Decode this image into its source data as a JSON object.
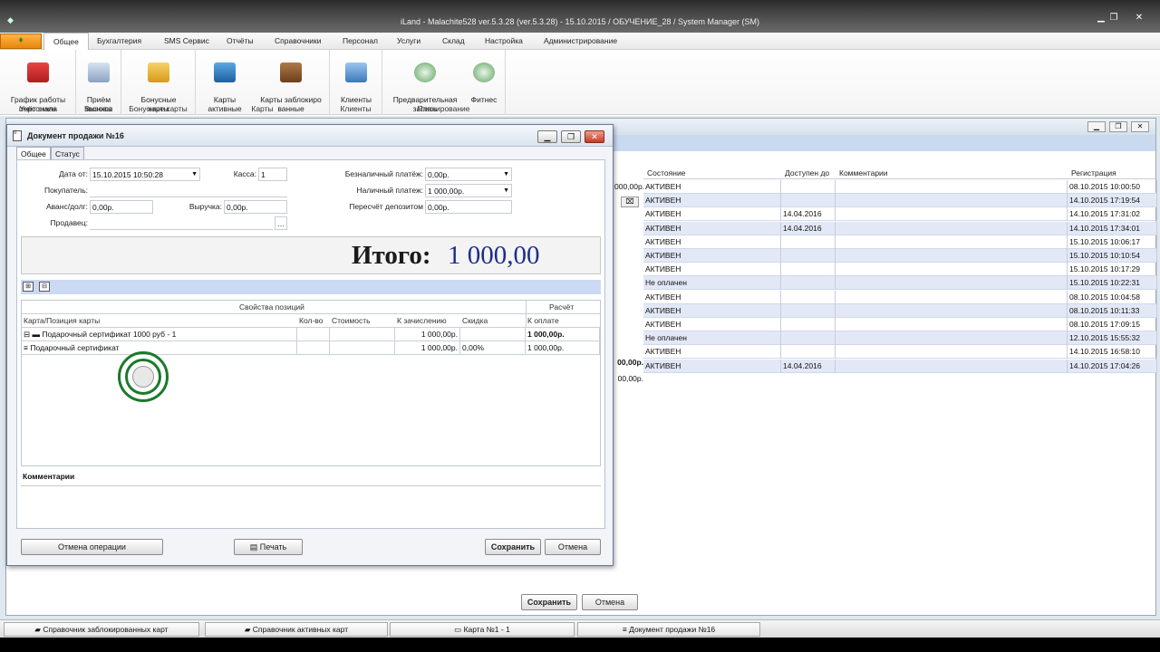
{
  "app": {
    "title": "iLand - Malachite528 ver.5.3.28 (ver.5.3.28) - 15.10.2015 / ОБУЧЕНИЕ_28 / System Manager (SM)"
  },
  "menu": [
    "Общее",
    "Бухгалтерия",
    "SMS Сервис",
    "Отчёты",
    "Справочники",
    "Персонал",
    "Услуги",
    "Склад",
    "Настройка",
    "Администрирование"
  ],
  "ribbon": {
    "groups": [
      {
        "caption": "Учёт смен",
        "buttons": [
          {
            "label": "График работы\nперсонала",
            "icon": "calendar-icon"
          }
        ]
      },
      {
        "caption": "Вызовы",
        "buttons": [
          {
            "label": "Приём\nзвонков",
            "icon": "phone-icon"
          }
        ]
      },
      {
        "caption": "Бонусные карты",
        "buttons": [
          {
            "label": "Бонусные\nкарты",
            "icon": "bonus-card-icon"
          }
        ]
      },
      {
        "caption": "Карты",
        "buttons": [
          {
            "label": "Карты\nактивные",
            "icon": "book-active-icon"
          },
          {
            "label": "Карты заблокиро\nванные",
            "icon": "book-locked-icon"
          }
        ]
      },
      {
        "caption": "Клиенты",
        "buttons": [
          {
            "label": "Клиенты",
            "icon": "clients-icon"
          }
        ]
      },
      {
        "caption": "Планирование",
        "buttons": [
          {
            "label": "Предварительная\nзапись",
            "icon": "booking-clock-icon"
          },
          {
            "label": "Фитнес",
            "icon": "fitness-clock-icon"
          }
        ]
      }
    ]
  },
  "bg_table": {
    "headers": [
      "Состояние",
      "Доступен до",
      "Комментарии",
      "Регистрация"
    ],
    "left_fragments": [
      "000,00р.",
      "00,00р.",
      "00,00р."
    ],
    "rows": [
      [
        "АКТИВЕН",
        "",
        "",
        "08.10.2015 10:00:50"
      ],
      [
        "АКТИВЕН",
        "",
        "",
        "14.10.2015 17:19:54"
      ],
      [
        "АКТИВЕН",
        "14.04.2016",
        "",
        "14.10.2015 17:31:02"
      ],
      [
        "АКТИВЕН",
        "14.04.2016",
        "",
        "14.10.2015 17:34:01"
      ],
      [
        "АКТИВЕН",
        "",
        "",
        "15.10.2015 10:06:17"
      ],
      [
        "АКТИВЕН",
        "",
        "",
        "15.10.2015 10:10:54"
      ],
      [
        "АКТИВЕН",
        "",
        "",
        "15.10.2015 10:17:29"
      ],
      [
        "Не оплачен",
        "",
        "",
        "15.10.2015 10:22:31"
      ],
      [
        "АКТИВЕН",
        "",
        "",
        "08.10.2015 10:04:58"
      ],
      [
        "АКТИВЕН",
        "",
        "",
        "08.10.2015 10:11:33"
      ],
      [
        "АКТИВЕН",
        "",
        "",
        "08.10.2015 17:09:15"
      ],
      [
        "Не оплачен",
        "",
        "",
        "12.10.2015 15:55:32"
      ],
      [
        "АКТИВЕН",
        "",
        "",
        "14.10.2015 16:58:10"
      ],
      [
        "АКТИВЕН",
        "14.04.2016",
        "",
        "14.10.2015 17:04:26"
      ]
    ],
    "save_label": "Сохранить",
    "cancel_label": "Отмена"
  },
  "dialog": {
    "title": "Документ продажи №16",
    "tabs": [
      "Общее",
      "Статус"
    ],
    "fields": {
      "date_label": "Дата от:",
      "date_value": "15.10.2015 10:50:28",
      "kassa_label": "Касса:",
      "kassa_value": "1",
      "buyer_label": "Покупатель:",
      "buyer_value": "",
      "advance_label": "Аванс/долг:",
      "advance_value": "0,00р.",
      "revenue_label": "Выручка:",
      "revenue_value": "0,00р.",
      "seller_label": "Продавец:",
      "seller_value": "",
      "cashless_label": "Безналичный платёж:",
      "cashless_value": "0,00р.",
      "cash_label": "Наличный платеж:",
      "cash_value": "1 000,00р.",
      "deposit_label": "Пересчёт депозитом",
      "deposit_value": "0,00р."
    },
    "total_label": "Итого:",
    "total_value": "1 000,00",
    "grid": {
      "group_header": "Свойства позиций",
      "calc_header": "Расчёт",
      "columns": [
        "Карта/Позиция карты",
        "Кол-во",
        "Стоимость",
        "К зачислению",
        "Скидка",
        "К оплате"
      ],
      "rows": [
        {
          "name": "Подарочный сертификат 1000 руб - 1",
          "qty": "",
          "cost": "",
          "credit": "1 000,00р.",
          "discount": "",
          "pay": "1 000,00р.",
          "level": 0
        },
        {
          "name": "Подарочный сертификат",
          "qty": "",
          "cost": "",
          "credit": "1 000,00р.",
          "discount": "0,00%",
          "pay": "1 000,00р.",
          "level": 1
        }
      ]
    },
    "comments_label": "Комментарии",
    "buttons": {
      "cancel_operation": "Отмена операции",
      "print": "Печать",
      "save": "Сохранить",
      "cancel": "Отмена"
    }
  },
  "taskbar": [
    "Справочник заблокированных карт",
    "Справочник активных карт",
    "Карта №1 - 1",
    "Документ продажи №16"
  ]
}
